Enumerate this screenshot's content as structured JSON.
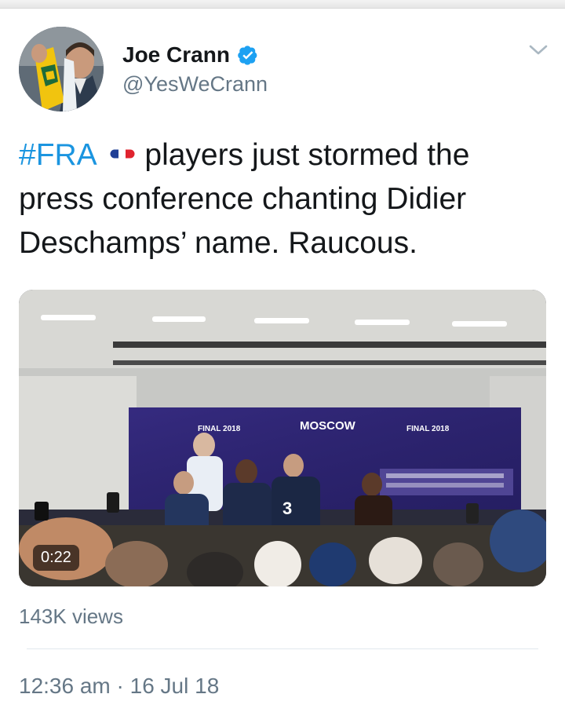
{
  "tweet": {
    "author": {
      "display_name": "Joe Crann",
      "handle": "@YesWeCrann",
      "verified": true,
      "avatar_icon": "avatar-photo"
    },
    "text": {
      "hashtag": "#FRA",
      "flag": "france-flag-emoji",
      "body_line1": "players just stormed the",
      "body_rest": "press conference chanting Didier Deschamps’ name. Raucous."
    },
    "media": {
      "type": "video",
      "duration": "0:22",
      "backdrop_text_center": "MOSCOW",
      "backdrop_text_left": "FINAL 2018",
      "backdrop_text_right": "FINAL 2018",
      "jersey_number": "3"
    },
    "views": "143K views",
    "timestamp": "12:36 am · 16 Jul 18"
  },
  "colors": {
    "link": "#1b95e0",
    "secondary_text": "#657786",
    "verified": "#1da1f2"
  },
  "icons": {
    "menu": "chevron-down-icon",
    "verified": "verified-badge-icon"
  }
}
